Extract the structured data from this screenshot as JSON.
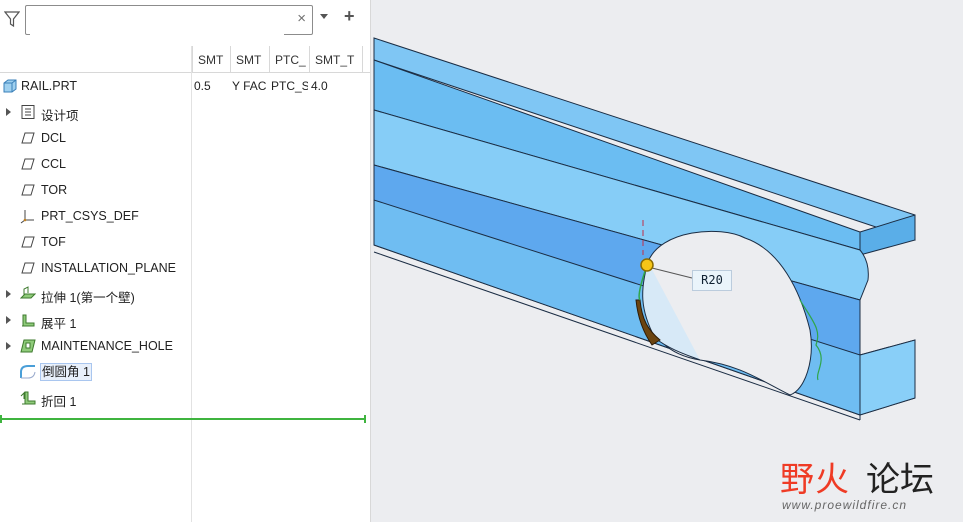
{
  "search": {
    "value": "",
    "placeholder": ""
  },
  "columns": [
    "SMT",
    "SMT",
    "PTC_",
    "SMT_T"
  ],
  "tree": [
    {
      "label": "RAIL.PRT",
      "icon": "part-icon",
      "cells": [
        "0.5",
        "Y FAC",
        "PTC_S",
        "4.0"
      ]
    },
    {
      "label": "设计项",
      "icon": "design-items-icon"
    },
    {
      "label": "DCL",
      "icon": "datum-plane-icon"
    },
    {
      "label": "CCL",
      "icon": "datum-plane-icon"
    },
    {
      "label": "TOR",
      "icon": "datum-plane-icon"
    },
    {
      "label": "PRT_CSYS_DEF",
      "icon": "csys-icon"
    },
    {
      "label": "TOF",
      "icon": "datum-plane-icon"
    },
    {
      "label": "INSTALLATION_PLANE",
      "icon": "datum-plane-icon"
    },
    {
      "label": "拉伸 1(第一个壁)",
      "icon": "extrude-wall-icon"
    },
    {
      "label": "展平 1",
      "icon": "unbend-icon"
    },
    {
      "label": "MAINTENANCE_HOLE",
      "icon": "cut-icon"
    },
    {
      "label": "倒圆角 1",
      "icon": "round-icon"
    },
    {
      "label": "折回 1",
      "icon": "bend-back-icon"
    }
  ],
  "viewport": {
    "dimension_label": "R20"
  },
  "watermark": {
    "title_a": "野火",
    "title_b": "论坛",
    "url": "www.proewildfire.cn"
  },
  "colors": {
    "model": "#7cc8f5",
    "model_dark": "#4f9ee0",
    "edge": "#1b2d44",
    "round_highlight": "#6b4410",
    "watermark": "#ef3b25"
  }
}
